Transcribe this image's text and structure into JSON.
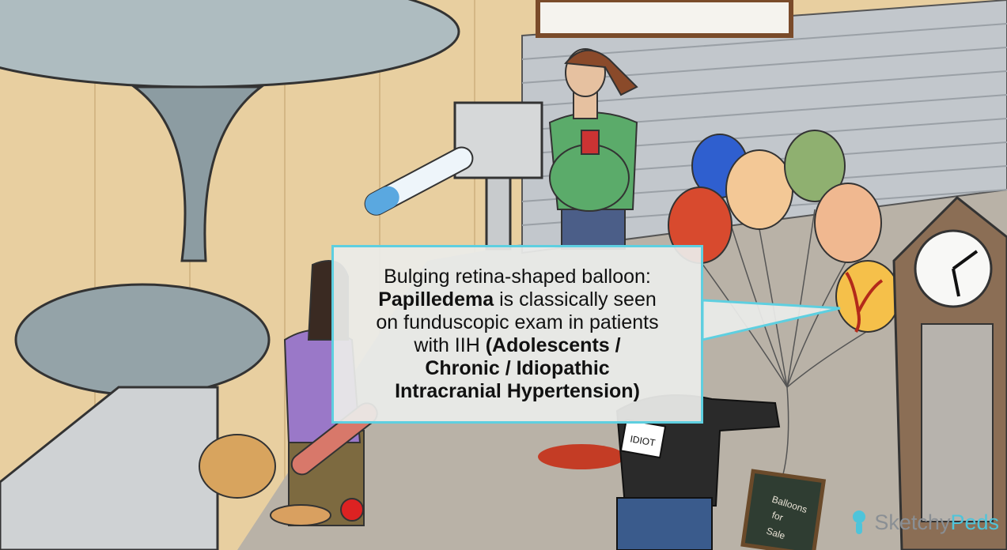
{
  "callout": {
    "line1": "Bulging retina-shaped balloon:",
    "line2_bold": "Papilledema",
    "line2_rest": " is classically seen",
    "line3": "on funduscopic exam in patients",
    "line4_plain": "with IIH ",
    "line4_bold": "(Adolescents /",
    "line5_bold": "Chronic / Idiopathic",
    "line6_bold": "Intracranial Hypertension)"
  },
  "badge_text": "IDIOT",
  "sign_text": [
    "Balloons",
    "for",
    "Sale"
  ],
  "brand": {
    "part1": "Sketchy",
    "part2": "Peds"
  },
  "colors": {
    "accent": "#5ecfe0",
    "wall": "#e8cfa0",
    "floor": "#b9b2a7",
    "table_top": "#aebcc0",
    "siding": "#c2c7cc"
  },
  "icons": [
    "sketchy-logo-icon"
  ]
}
